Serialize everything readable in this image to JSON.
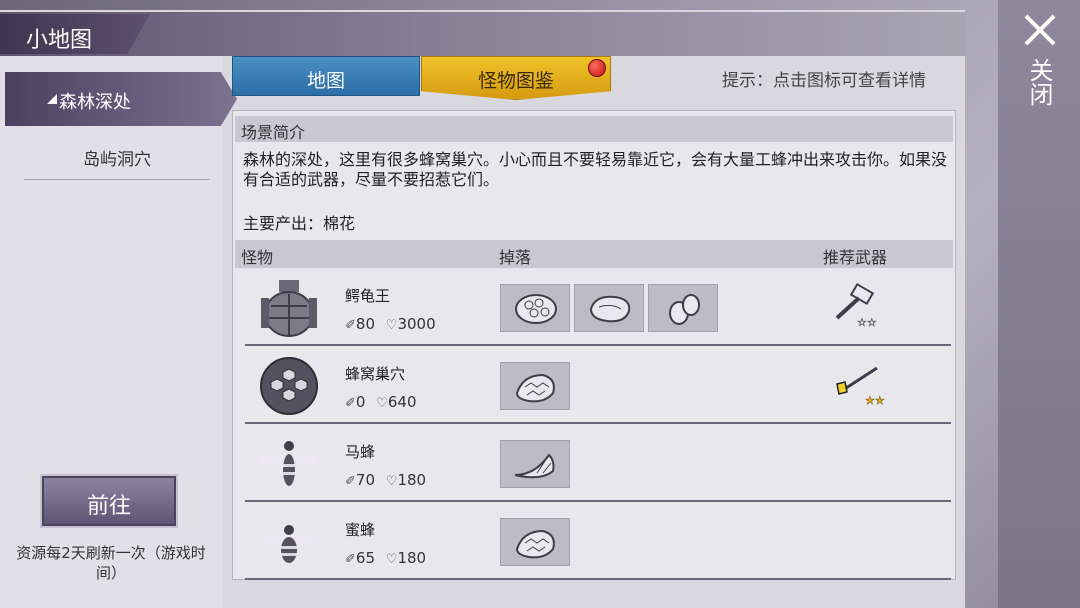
{
  "window": {
    "title": "小地图"
  },
  "sidebar": {
    "items": [
      {
        "label": "森林深处",
        "active": true
      },
      {
        "label": "岛屿洞穴",
        "active": false
      }
    ],
    "go_button": "前往",
    "refresh_note": "资源每2天刷新一次（游戏时间）"
  },
  "tabs": [
    {
      "label": "地图",
      "active": false
    },
    {
      "label": "怪物图鉴",
      "active": true,
      "badge": "red-dot"
    }
  ],
  "hint": "提示：点击图标可查看详情",
  "scene": {
    "header": "场景简介",
    "description": "森林的深处，这里有很多蜂窝巢穴。小心而且不要轻易靠近它，会有大量工蜂冲出来攻击你。如果没有合适的武器，尽量不要招惹它们。",
    "output": "主要产出：棉花"
  },
  "table": {
    "headers": {
      "monster": "怪物",
      "drops": "掉落",
      "weapon": "推荐武器"
    },
    "rows": [
      {
        "name": "鳄龟王",
        "attack": "80",
        "hp": "3000",
        "icon": "turtle-king-icon",
        "drops": [
          "rock-ore-icon",
          "meat-icon",
          "eggs-icon"
        ],
        "weapon": "hammer-icon",
        "stars": "☆☆"
      },
      {
        "name": "蜂窝巢穴",
        "attack": "0",
        "hp": "640",
        "icon": "beehive-icon",
        "drops": [
          "honeycomb-icon"
        ],
        "weapon": "torch-icon",
        "stars": "★★"
      },
      {
        "name": "马蜂",
        "attack": "70",
        "hp": "180",
        "icon": "hornet-icon",
        "drops": [
          "horn-icon"
        ],
        "weapon": "",
        "stars": ""
      },
      {
        "name": "蜜蜂",
        "attack": "65",
        "hp": "180",
        "icon": "bee-icon",
        "drops": [
          "honeycomb-icon"
        ],
        "weapon": "",
        "stars": ""
      }
    ]
  },
  "close": {
    "label": "关闭"
  },
  "colors": {
    "tab_active": "#e3ad1a",
    "tab_inactive": "#3b7fb8",
    "panel": "#d9d8de",
    "accent_dark": "#4a4260"
  }
}
